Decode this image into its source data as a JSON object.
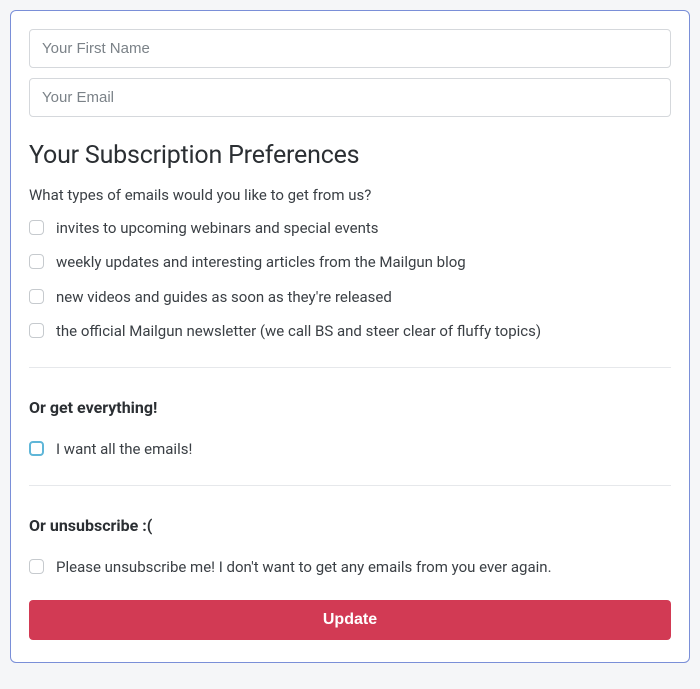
{
  "inputs": {
    "first_name_placeholder": "Your First Name",
    "email_placeholder": "Your Email"
  },
  "heading": "Your Subscription Preferences",
  "question": "What types of emails would you like to get from us?",
  "options": {
    "webinars": "invites to upcoming webinars and special events",
    "weekly": "weekly updates and interesting articles from the Mailgun blog",
    "videos": "new videos and guides as soon as they're released",
    "newsletter": "the official Mailgun newsletter (we call BS and steer clear of fluffy topics)"
  },
  "everything": {
    "heading": "Or get everything!",
    "label": "I want all the emails!"
  },
  "unsubscribe": {
    "heading": "Or unsubscribe :(",
    "label": "Please unsubscribe me! I don't want to get any emails from you ever again."
  },
  "button": {
    "update": "Update"
  }
}
